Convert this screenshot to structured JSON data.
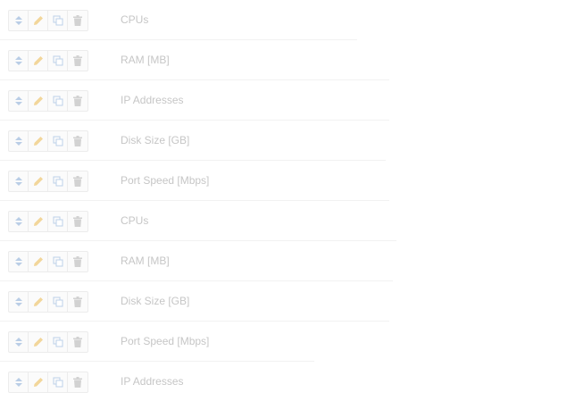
{
  "items": [
    {
      "label": "CPUs"
    },
    {
      "label": "RAM [MB]"
    },
    {
      "label": "IP Addresses"
    },
    {
      "label": "Disk Size [GB]"
    },
    {
      "label": "Port Speed [Mbps]"
    },
    {
      "label": "CPUs"
    },
    {
      "label": "RAM [MB]"
    },
    {
      "label": "Disk Size [GB]"
    },
    {
      "label": "Port Speed [Mbps]"
    },
    {
      "label": "IP Addresses"
    }
  ],
  "icons": {
    "sort": "sort-icon",
    "edit": "pencil-icon",
    "duplicate": "copy-icon",
    "delete": "trash-icon"
  },
  "colors": {
    "sort": "#b9cde6",
    "edit": "#f2d69a",
    "duplicate": "#bcd0e8",
    "delete": "#d2d2d2",
    "label": "#c6c6c6",
    "divider": "#f2f2f2"
  }
}
